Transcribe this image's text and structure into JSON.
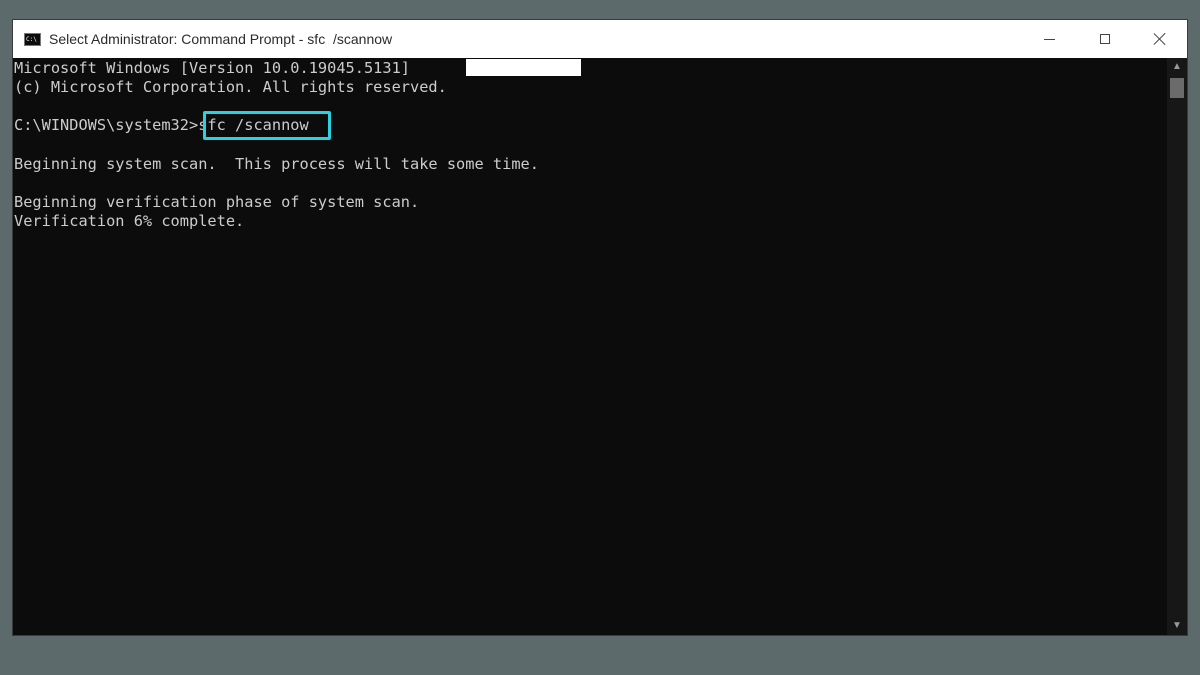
{
  "window": {
    "title": "Select Administrator: Command Prompt - sfc  /scannow",
    "icon": "cmd-icon",
    "controls": [
      "minimize-icon",
      "maximize-icon",
      "close-icon"
    ]
  },
  "console": {
    "lines": [
      "Microsoft Windows [Version 10.0.19045.5131]",
      "(c) Microsoft Corporation. All rights reserved.",
      "",
      "C:\\WINDOWS\\system32>sfc /scannow",
      "",
      "Beginning system scan.  This process will take some time.",
      "",
      "Beginning verification phase of system scan.",
      "Verification 6% complete."
    ],
    "highlighted_command": "sfc /scannow",
    "highlight_color": "#2ad2e0"
  },
  "colors": {
    "console_bg": "#0c0c0c",
    "console_text": "#cccccc",
    "titlebar_bg": "#ffffff",
    "desktop_bg": "#5d6a6b"
  }
}
